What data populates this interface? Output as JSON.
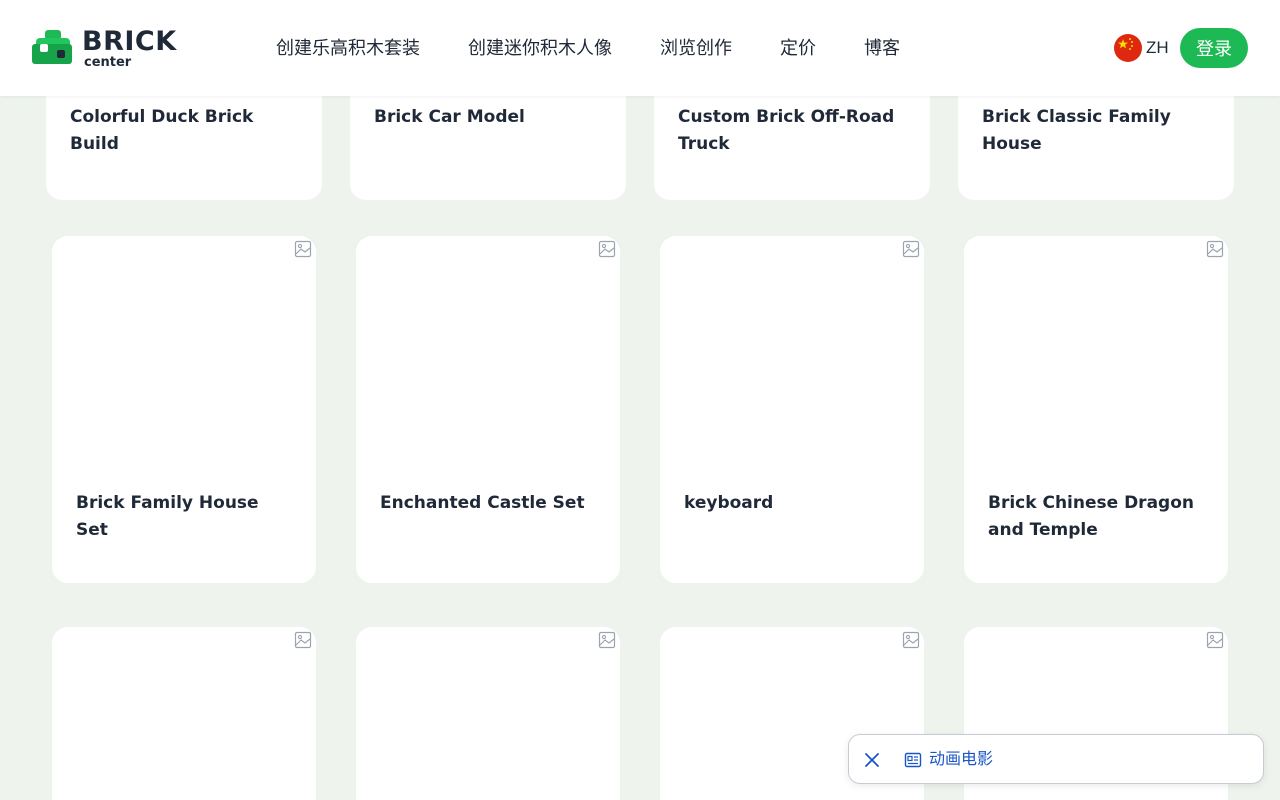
{
  "header": {
    "logo": {
      "word": "BRICK",
      "sub": "center"
    },
    "nav": [
      {
        "label": "创建乐高积木套装"
      },
      {
        "label": "创建迷你积木人像"
      },
      {
        "label": "浏览创作"
      },
      {
        "label": "定价"
      },
      {
        "label": "博客"
      }
    ],
    "language": {
      "label": "ZH",
      "flag_icon": "china-flag-icon"
    },
    "login_label": "登录"
  },
  "colors": {
    "background": "#eef3ee",
    "accent_green": "#1db954",
    "card": "#ffffff",
    "link_blue": "#1a56c8"
  },
  "gallery": {
    "row1": [
      {
        "title": "Colorful Duck Brick Build"
      },
      {
        "title": "Brick Car Model"
      },
      {
        "title": "Custom Brick Off-Road Truck"
      },
      {
        "title": "Brick Classic Family House"
      }
    ],
    "row2": [
      {
        "title": "Brick Family House Set",
        "icon": "image-placeholder-icon"
      },
      {
        "title": "Enchanted Castle Set",
        "icon": "image-placeholder-icon"
      },
      {
        "title": "keyboard",
        "icon": "image-placeholder-icon"
      },
      {
        "title": "Brick Chinese Dragon and Temple",
        "icon": "image-placeholder-icon"
      }
    ],
    "row3": [
      {
        "icon": "image-placeholder-icon"
      },
      {
        "icon": "image-placeholder-icon"
      },
      {
        "icon": "image-placeholder-icon"
      },
      {
        "icon": "image-placeholder-icon"
      }
    ]
  },
  "floating_bar": {
    "close_icon": "close-icon",
    "item_icon": "newspaper-icon",
    "label": "动画电影"
  }
}
